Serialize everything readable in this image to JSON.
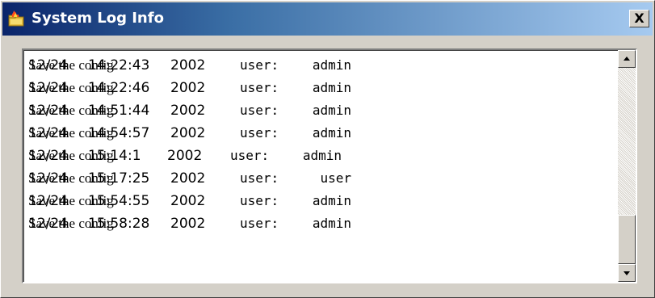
{
  "window": {
    "title": "System Log Info",
    "close_label": "X",
    "app_icon": "burning-folder-icon",
    "titlebar_colors": [
      "#0a246a",
      "#a6caf0"
    ]
  },
  "log": {
    "label_text": "user:",
    "message_text": "Save the config",
    "rows": [
      {
        "date": "12/24",
        "time": "14:22:43",
        "year": "2002",
        "label": "user:",
        "user": "admin",
        "message": "Save the config"
      },
      {
        "date": "12/24",
        "time": "14:22:46",
        "year": "2002",
        "label": "user:",
        "user": "admin",
        "message": "Save the config"
      },
      {
        "date": "12/24",
        "time": "14:51:44",
        "year": "2002",
        "label": "user:",
        "user": "admin",
        "message": "Save the config"
      },
      {
        "date": "12/24",
        "time": "14:54:57",
        "year": "2002",
        "label": "user:",
        "user": "admin",
        "message": "Save the config"
      },
      {
        "date": "12/24",
        "time": "15:14:1",
        "year": "2002",
        "label": "user:",
        "user": "admin",
        "message": "Save the config"
      },
      {
        "date": "12/24",
        "time": "15:17:25",
        "year": "2002",
        "label": "user:",
        "user": "user",
        "message": "Save the config"
      },
      {
        "date": "12/24",
        "time": "15:54:55",
        "year": "2002",
        "label": "user:",
        "user": "admin",
        "message": "Save the config"
      },
      {
        "date": "12/24",
        "time": "15:58:28",
        "year": "2002",
        "label": "user:",
        "user": "admin",
        "message": "Save the config"
      }
    ]
  },
  "scrollbar": {
    "up_icon": "scroll-up-arrow-icon",
    "down_icon": "scroll-down-arrow-icon",
    "position_fraction": 1.0
  }
}
